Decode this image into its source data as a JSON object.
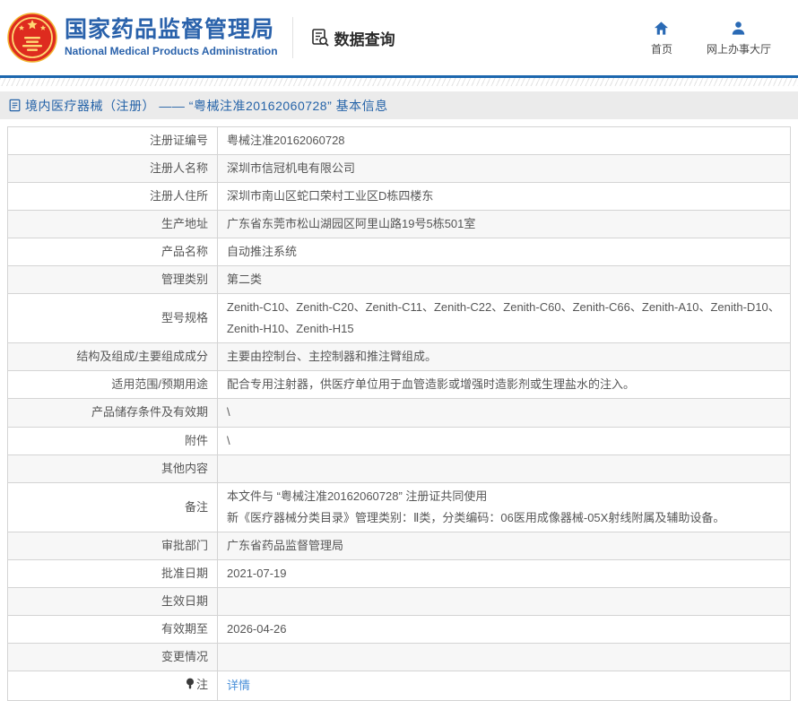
{
  "header": {
    "org_name_zh": "国家药品监督管理局",
    "org_name_en": "National Medical Products Administration",
    "data_query_label": "数据查询",
    "nav": [
      {
        "label": "首页",
        "icon": "home-icon"
      },
      {
        "label": "网上办事大厅",
        "icon": "person-icon"
      }
    ]
  },
  "colors": {
    "brand_blue": "#2a62ab",
    "line_blue": "#1c67ae",
    "breadcrumb_bg": "#ebebeb",
    "link_blue": "#4a90d9",
    "emblem_red": "#de2b1f",
    "emblem_gold": "#ffd873"
  },
  "breadcrumb": {
    "text": "境内医疗器械（注册） —— “粤械注准20162060728” 基本信息"
  },
  "table": {
    "rows": [
      {
        "label": "注册证编号",
        "value": "粤械注准20162060728"
      },
      {
        "label": "注册人名称",
        "value": "深圳市信冠机电有限公司"
      },
      {
        "label": "注册人住所",
        "value": "深圳市南山区蛇口荣村工业区D栋四楼东"
      },
      {
        "label": "生产地址",
        "value": "广东省东莞市松山湖园区阿里山路19号5栋501室"
      },
      {
        "label": "产品名称",
        "value": "自动推注系统"
      },
      {
        "label": "管理类别",
        "value": "第二类"
      },
      {
        "label": "型号规格",
        "value": "Zenith-C10、Zenith-C20、Zenith-C11、Zenith-C22、Zenith-C60、Zenith-C66、Zenith-A10、Zenith-D10、Zenith-H10、Zenith-H15"
      },
      {
        "label": "结构及组成/主要组成成分",
        "value": "主要由控制台、主控制器和推注臂组成。"
      },
      {
        "label": "适用范围/预期用途",
        "value": "配合专用注射器，供医疗单位用于血管造影或增强时造影剂或生理盐水的注入。"
      },
      {
        "label": "产品储存条件及有效期",
        "value": "\\"
      },
      {
        "label": "附件",
        "value": "\\"
      },
      {
        "label": "其他内容",
        "value": ""
      },
      {
        "label": "备注",
        "value": "本文件与 “粤械注准20162060728” 注册证共同使用\n新《医疗器械分类目录》管理类别：Ⅱ类，分类编码：06医用成像器械-05X射线附属及辅助设备。"
      },
      {
        "label": "审批部门",
        "value": "广东省药品监督管理局"
      },
      {
        "label": "批准日期",
        "value": "2021-07-19"
      },
      {
        "label": "生效日期",
        "value": ""
      },
      {
        "label": "有效期至",
        "value": "2026-04-26"
      },
      {
        "label": "变更情况",
        "value": ""
      },
      {
        "label": "注",
        "value": "详情",
        "icon": "bulb-icon",
        "link": true
      }
    ]
  }
}
